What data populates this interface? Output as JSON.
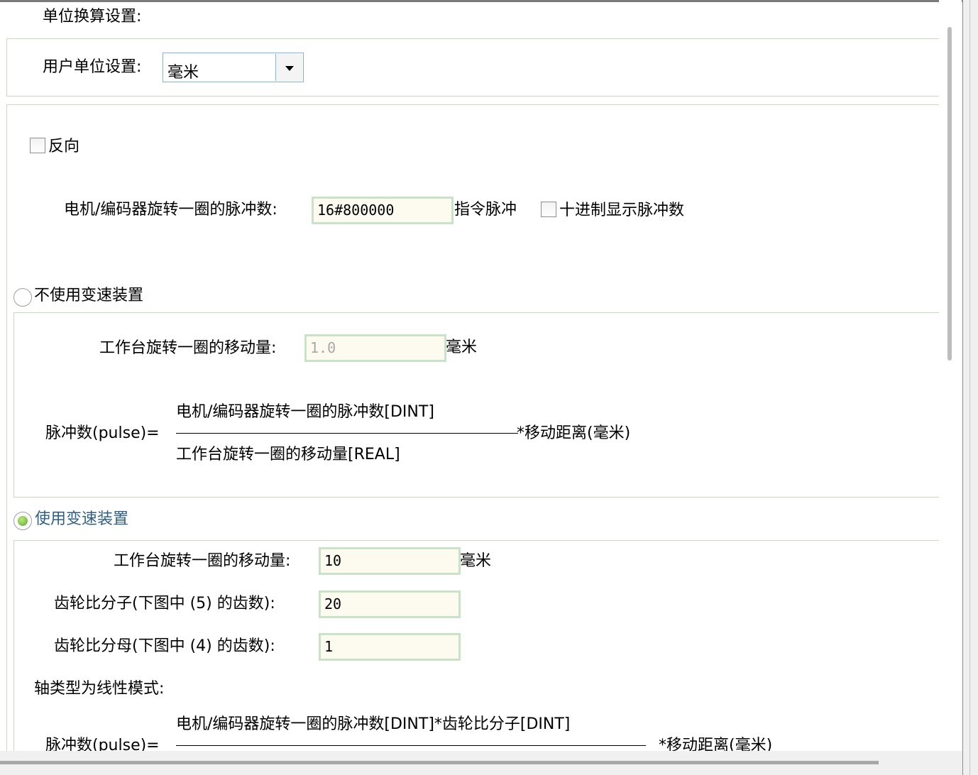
{
  "unit_section": {
    "title": "单位换算设置:",
    "user_unit_label": "用户单位设置:",
    "user_unit_value": "毫米"
  },
  "reverse": {
    "label": "反向",
    "checked": false
  },
  "pulses": {
    "label": "电机/编码器旋转一圈的脉冲数:",
    "value": "16#800000",
    "suffix": "指令脉冲",
    "decimal_label": "十进制显示脉冲数",
    "decimal_checked": false
  },
  "no_gear": {
    "label": "不使用变速装置",
    "selected": false,
    "travel_label": "工作台旋转一圈的移动量:",
    "travel_value": "1.0",
    "travel_unit": "毫米",
    "formula": {
      "lhs": "脉冲数(pulse)=",
      "numerator": "电机/编码器旋转一圈的脉冲数[DINT]",
      "denominator": "工作台旋转一圈的移动量[REAL]",
      "rhs": "*移动距离(毫米)"
    }
  },
  "use_gear": {
    "label": "使用变速装置",
    "selected": true,
    "travel_label": "工作台旋转一圈的移动量:",
    "travel_value": "10",
    "travel_unit": "毫米",
    "numerator_label": "齿轮比分子(下图中 (5) 的齿数):",
    "numerator_value": "20",
    "denominator_label": "齿轮比分母(下图中 (4) 的齿数):",
    "denominator_value": "1",
    "axis_mode_label": "轴类型为线性模式:",
    "formula": {
      "lhs": "脉冲数(pulse)=",
      "numerator": "电机/编码器旋转一圈的脉冲数[DINT]*齿轮比分子[DINT]",
      "rhs": "*移动距离(毫米)"
    }
  },
  "colors": {
    "field_bg": "#fdfaef",
    "field_border": "#c8e3c6",
    "frame_border": "#c4dcc4",
    "selected_radio": "#5fa831",
    "selected_text": "#2f5f86"
  }
}
